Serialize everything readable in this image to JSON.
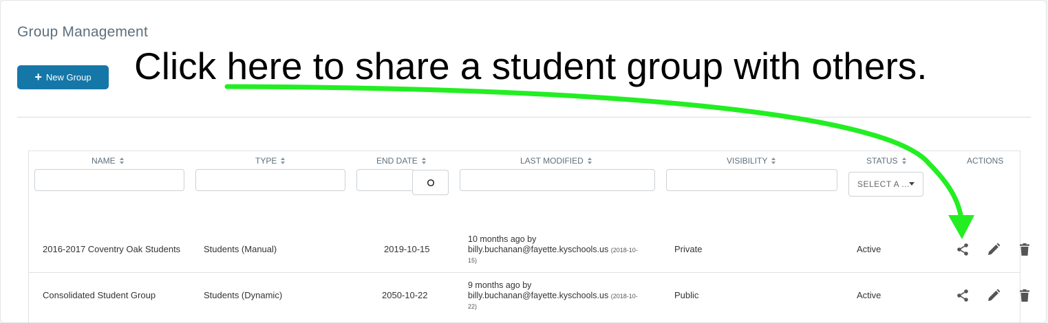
{
  "page": {
    "title": "Group Management",
    "new_group_label": "New Group",
    "annotation": "Click here to share a student group with others."
  },
  "table": {
    "headers": [
      "NAME",
      "TYPE",
      "END DATE",
      "LAST MODIFIED",
      "VISIBILITY",
      "STATUS",
      "ACTIONS"
    ],
    "status_filter_placeholder": "SELECT A ...",
    "rows": [
      {
        "name": "2016-2017 Coventry Oak Students",
        "type": "Students (Manual)",
        "end_date": "2019-10-15",
        "modified_line1": "10 months ago by",
        "modified_user": "billy.buchanan@fayette.kyschools.us",
        "modified_date_a": "(2018-10-",
        "modified_date_b": "15)",
        "visibility": "Private",
        "status": "Active"
      },
      {
        "name": "Consolidated Student Group",
        "type": "Students (Dynamic)",
        "end_date": "2050-10-22",
        "modified_line1": "9 months ago by",
        "modified_user": "billy.buchanan@fayette.kyschools.us",
        "modified_date_a": "(2018-10-",
        "modified_date_b": "22)",
        "visibility": "Public",
        "status": "Active"
      }
    ]
  },
  "icons": {
    "actions": [
      "share-icon",
      "pencil-icon",
      "trash-icon"
    ],
    "sort": "sort-icon",
    "date_picker": "circle-icon"
  },
  "colors": {
    "primary_button": "#1577a8",
    "title": "#5d6f7d",
    "annotation_arrow": "#22ee22",
    "icon": "#555555"
  }
}
